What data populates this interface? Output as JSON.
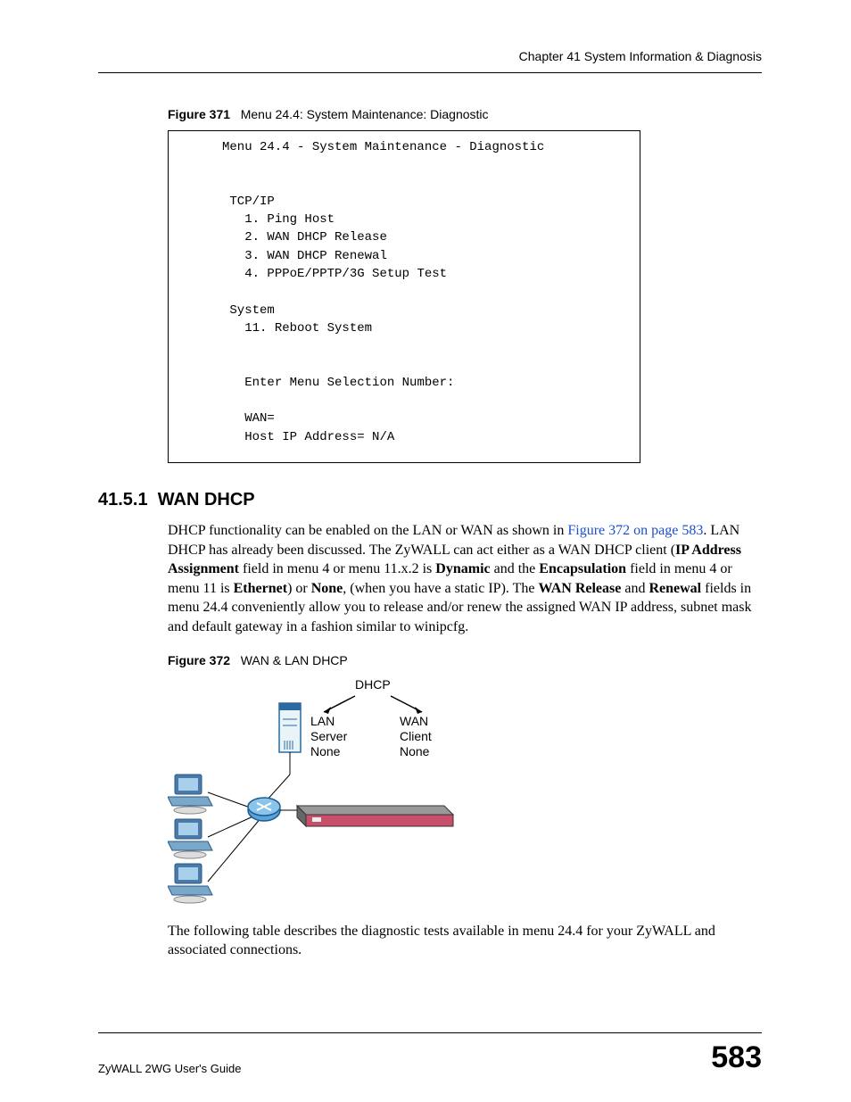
{
  "header": {
    "chapter": "Chapter 41 System Information & Diagnosis"
  },
  "figure371": {
    "label": "Figure 371",
    "caption": "Menu 24.4: System Maintenance: Diagnostic",
    "terminal": {
      "title": "Menu 24.4 - System Maintenance - Diagnostic",
      "section1": "TCP/IP",
      "item1": "1. Ping Host",
      "item2": "2. WAN DHCP Release",
      "item3": "3. WAN DHCP Renewal",
      "item4": "4. PPPoE/PPTP/3G Setup Test",
      "section2": "System",
      "item11": "11. Reboot System",
      "prompt": "Enter Menu Selection Number:",
      "wan": "WAN=",
      "host": "Host IP Address= N/A"
    }
  },
  "section": {
    "number": "41.5.1",
    "title": "WAN DHCP"
  },
  "para1": {
    "t1": "DHCP functionality can be enabled on the LAN or WAN as shown in ",
    "link": "Figure 372 on page 583",
    "t2": ". LAN DHCP has already been discussed. The ZyWALL can act either as a WAN DHCP client (",
    "b1": "IP Address Assignment",
    "t3": " field in menu 4 or menu 11.x.2 is ",
    "b2": "Dynamic",
    "t4": " and the ",
    "b3": "Encapsulation",
    "t5": " field in menu 4 or menu 11 is ",
    "b4": "Ethernet",
    "t6": ") or ",
    "b5": "None",
    "t7": ", (when you have a static IP). The ",
    "b6": "WAN Release",
    "t8": " and ",
    "b7": "Renewal",
    "t9": " fields in menu 24.4 conveniently allow you to release and/or renew the assigned WAN IP address, subnet mask and default gateway in a fashion similar to winipcfg."
  },
  "figure372": {
    "label": "Figure 372",
    "caption": "WAN & LAN DHCP",
    "diagram": {
      "dhcp": "DHCP",
      "lan1": "LAN",
      "lan2": "Server",
      "lan3": "None",
      "wan1": "WAN",
      "wan2": "Client",
      "wan3": "None"
    }
  },
  "para2": "The following table describes the diagnostic tests available in menu 24.4 for your ZyWALL and associated connections.",
  "footer": {
    "guide": "ZyWALL 2WG User's Guide",
    "page": "583"
  }
}
